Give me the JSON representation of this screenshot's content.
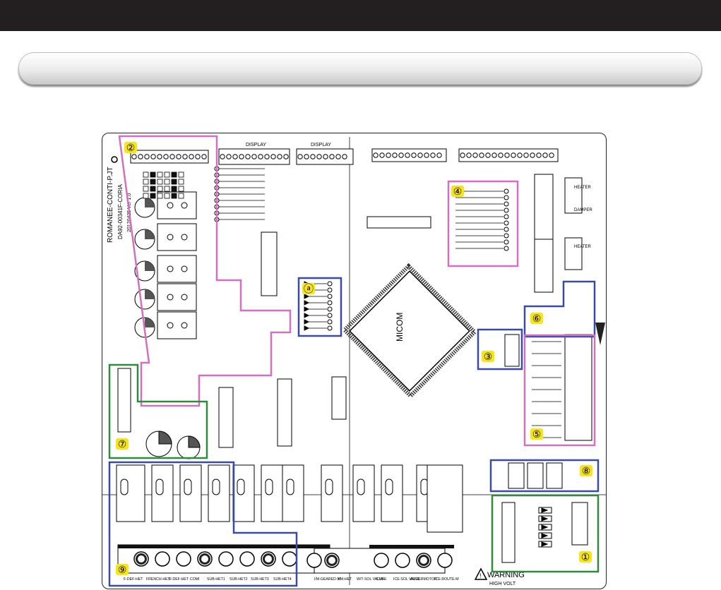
{
  "colors": {
    "topbar": "#231f20",
    "pink": "#d36fc1",
    "blue": "#3a4aa8",
    "green": "#2e8b3a",
    "badge": "#f7e51a"
  },
  "board": {
    "side_title": "ROMANEE-CONTI-P.JT",
    "side_sub": "DA92-00341F-CORIA",
    "side_date": "20120425 Ver 1.0",
    "display_1": "DISPLAY",
    "display_2": "DISPLAY",
    "micom": "MICOM",
    "right_labels": [
      "HEATER",
      "DAMPER",
      "HEATER"
    ],
    "warning": "WARNING",
    "high_volt": "HIGH VOLT"
  },
  "markers": {
    "m1": "①",
    "m2": "②",
    "m3": "③",
    "m4": "④",
    "m5": "⑤",
    "m6": "⑥",
    "m7": "⑦",
    "m8": "⑧",
    "m9": "⑨",
    "ma": "ⓐ"
  },
  "bottom_labels": [
    "F-DEF-HET",
    "FRENCH-HET",
    "R-DEF-HET",
    "COMI",
    "SUB-HET1",
    "SUB-HET2",
    "SUB-HET3",
    "SUB-HET4",
    "I/M-GEARED-M",
    "I/M-HET",
    "W/T-SOL VALVE",
    "CUBE",
    "ICE-SOL VALVE",
    "AUGERMOTOR",
    "ICE-ROUTE-M"
  ]
}
